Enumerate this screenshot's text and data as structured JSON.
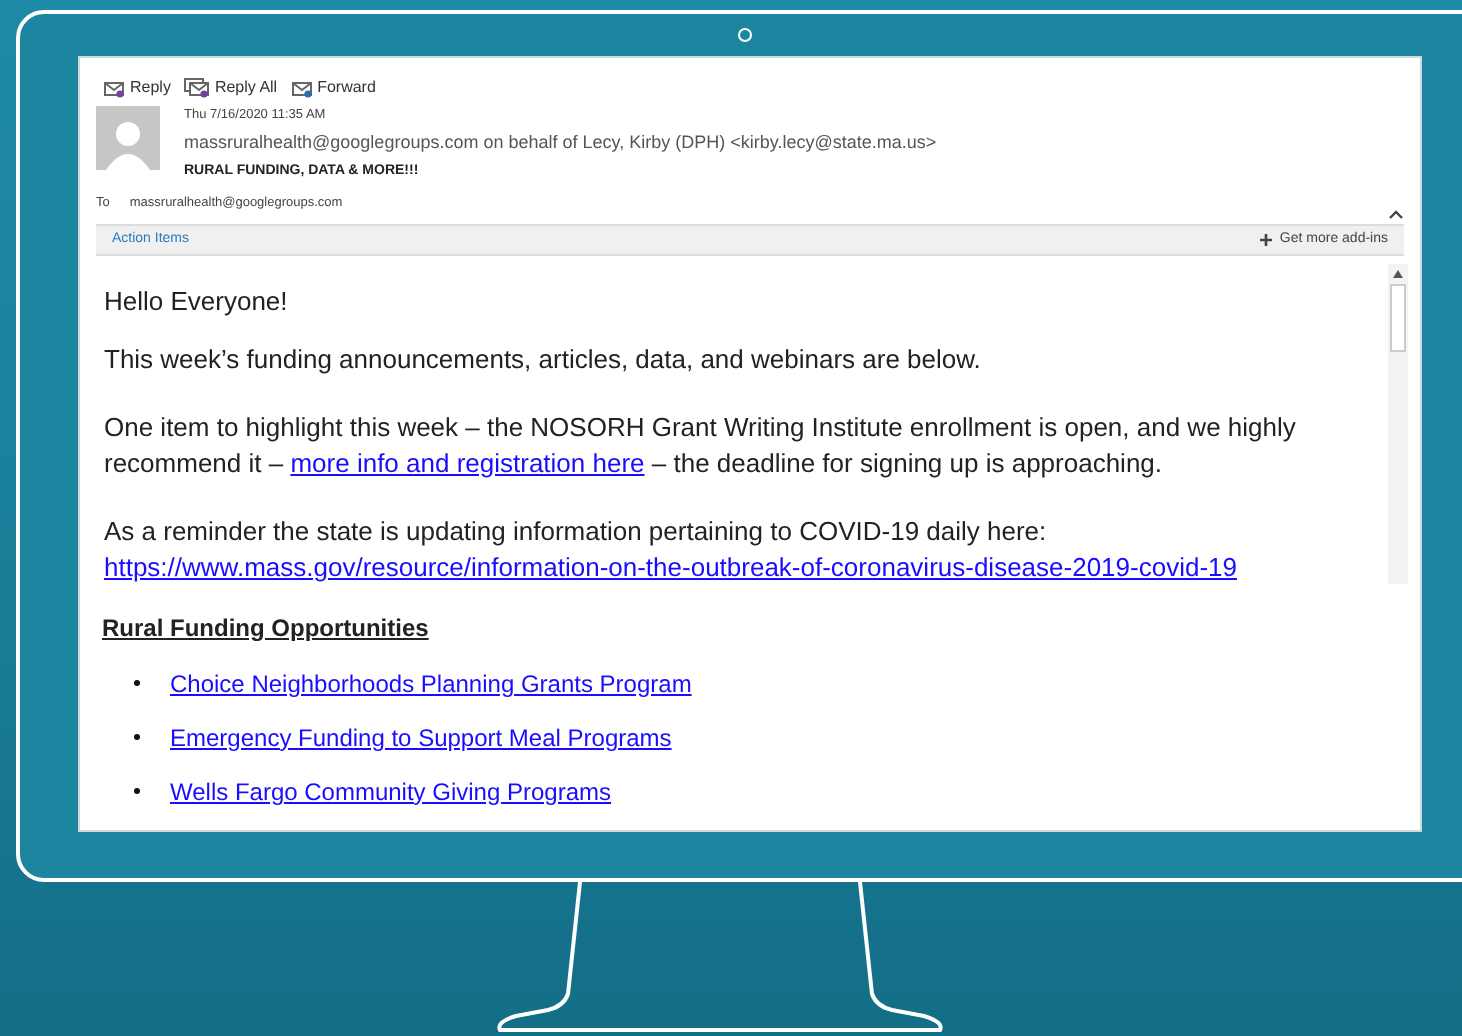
{
  "toolbar": [
    {
      "kind": "reply",
      "label": "Reply"
    },
    {
      "kind": "reply_all",
      "label": "Reply All"
    },
    {
      "kind": "forward",
      "label": "Forward"
    }
  ],
  "message": {
    "date": "Thu 7/16/2020 11:35 AM",
    "sender": "massruralhealth@googlegroups.com on behalf of Lecy, Kirby (DPH) <kirby.lecy@state.ma.us>",
    "subject": "RURAL FUNDING, DATA & MORE!!!",
    "to_label": "To",
    "to": "massruralhealth@googlegroups.com"
  },
  "action_bar": {
    "label": "Action Items",
    "addins": "Get more add-ins"
  },
  "body": {
    "greeting": "Hello Everyone!",
    "intro": "This week’s funding announcements, articles, data, and webinars are below.",
    "highlight_before": "One item to highlight this week – the NOSORH Grant Writing Institute enrollment is open, and we highly recommend it –",
    "highlight_link": "more info and registration here",
    "highlight_after": "– the deadline for signing up is approaching.",
    "reminder": "As a reminder the state is updating information pertaining to COVID-19 daily here:",
    "reminder_link": "https://www.mass.gov/resource/information-on-the-outbreak-of-coronavirus-disease-2019-covid-19"
  },
  "section": {
    "heading": "Rural Funding Opportunities",
    "links": [
      "Choice Neighborhoods Planning Grants Program",
      "Emergency Funding to Support Meal Programs",
      "Wells Fargo Community Giving Programs"
    ]
  }
}
